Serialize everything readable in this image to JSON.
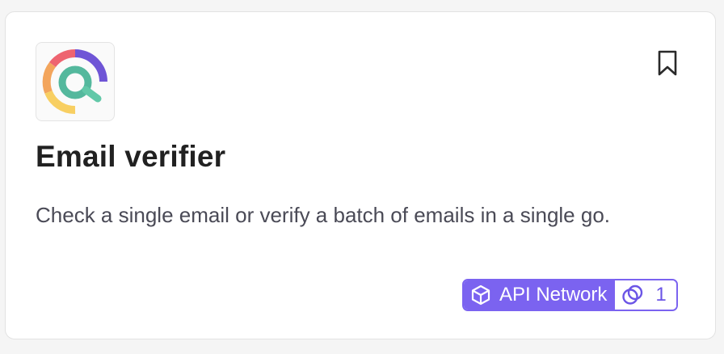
{
  "card": {
    "title": "Email verifier",
    "description": "Check a single email or verify a batch of emails in a single go.",
    "logo_icon": "email-verifier-logo",
    "bookmark_icon": "bookmark-icon"
  },
  "badge": {
    "label": "API Network",
    "icon": "cube-icon",
    "count": "1",
    "count_icon": "fork-circles-icon",
    "accent_color": "#7b63f0"
  }
}
